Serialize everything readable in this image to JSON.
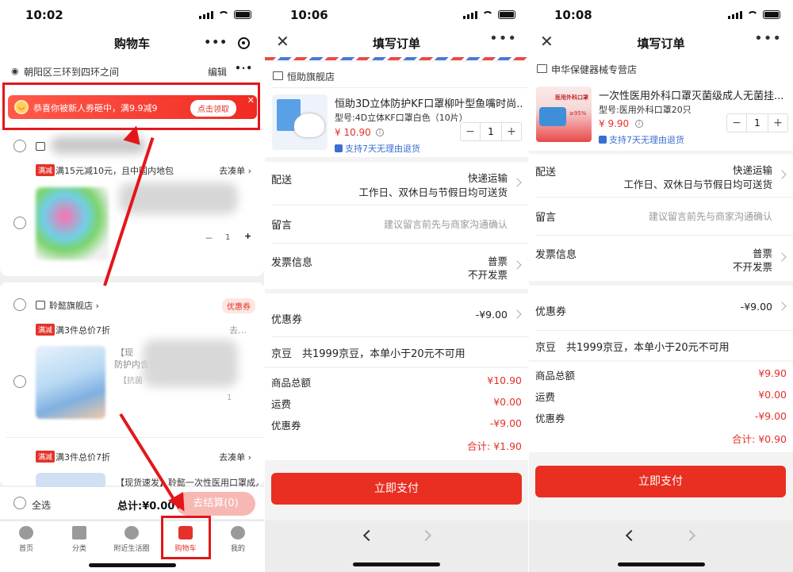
{
  "status_times": [
    "10:02",
    "10:06",
    "10:08"
  ],
  "cart": {
    "title": "购物车",
    "location": "朝阳区三环到四环之间",
    "edit": "编辑",
    "banner_text": "恭喜你被新人券砸中，满9.9减9",
    "banner_button": "点击领取",
    "promo_tag": "满减",
    "promo1": "满15元减10元，且中国内地包",
    "shop2": "聆懿旗舰店",
    "coupon_tag": "优惠券",
    "promo2": "满3件总价7折",
    "promo3": "满3件总价7折",
    "item2_title1": "【现",
    "item2_title2": "防护内含熔",
    "item2_title3": "【抗菌",
    "item3_title": "【现货速发】聆懿一次性医用口罩成人",
    "go_coudan": "去凑单",
    "qty": "1",
    "select_all": "全选",
    "total": "总计:¥0.00",
    "checkout": "去结算(0)",
    "tabs": [
      "首页",
      "分类",
      "附近生活圈",
      "购物车",
      "我的"
    ]
  },
  "order1": {
    "title": "填写订单",
    "shop": "恒助旗舰店",
    "product": "恒助3D立体防护KF口罩柳叶型鱼嘴时尚...",
    "spec": "型号:4D立体KF口罩白色（10片）",
    "price": "¥ 10.90",
    "qty": "1",
    "refund": "支持7天无理由退货",
    "delivery_label": "配送",
    "delivery_value1": "快递运输",
    "delivery_value2": "工作日、双休日与节假日均可送货",
    "message_label": "留言",
    "message_placeholder": "建议留言前先与商家沟通确认",
    "invoice_label": "发票信息",
    "invoice_value1": "普票",
    "invoice_value2": "不开发票",
    "coupon_label": "优惠券",
    "coupon_value": "-¥9.00",
    "jingdou": "京豆　共1999京豆，本单小于20元不可用",
    "goods_total_label": "商品总额",
    "goods_total": "¥10.90",
    "shipping_label": "运费",
    "shipping": "¥0.00",
    "coupon_row_label": "优惠券",
    "coupon_row": "-¥9.00",
    "sum": "合计: ¥1.90",
    "pay": "立即支付"
  },
  "order2": {
    "title": "填写订单",
    "shop": "申华保健器械专营店",
    "product": "一次性医用外科口罩灭菌级成人无菌挂...",
    "spec": "型号:医用外科口罩20只",
    "price": "¥ 9.90",
    "qty": "1",
    "refund": "支持7天无理由退货",
    "delivery_label": "配送",
    "delivery_value1": "快递运输",
    "delivery_value2": "工作日、双休日与节假日均可送货",
    "message_label": "留言",
    "message_placeholder": "建议留言前先与商家沟通确认",
    "invoice_label": "发票信息",
    "invoice_value1": "普票",
    "invoice_value2": "不开发票",
    "coupon_label": "优惠券",
    "coupon_value": "-¥9.00",
    "jingdou": "京豆　共1999京豆，本单小于20元不可用",
    "goods_total_label": "商品总额",
    "goods_total": "¥9.90",
    "shipping_label": "运费",
    "shipping": "¥0.00",
    "coupon_row_label": "优惠券",
    "coupon_row": "-¥9.00",
    "sum": "合计: ¥0.90",
    "pay": "立即支付",
    "img_text1": "医用外科口罩",
    "img_text2": "≥95%"
  },
  "colors": {
    "accent": "#e4322a",
    "annotation": "#e3161a"
  }
}
